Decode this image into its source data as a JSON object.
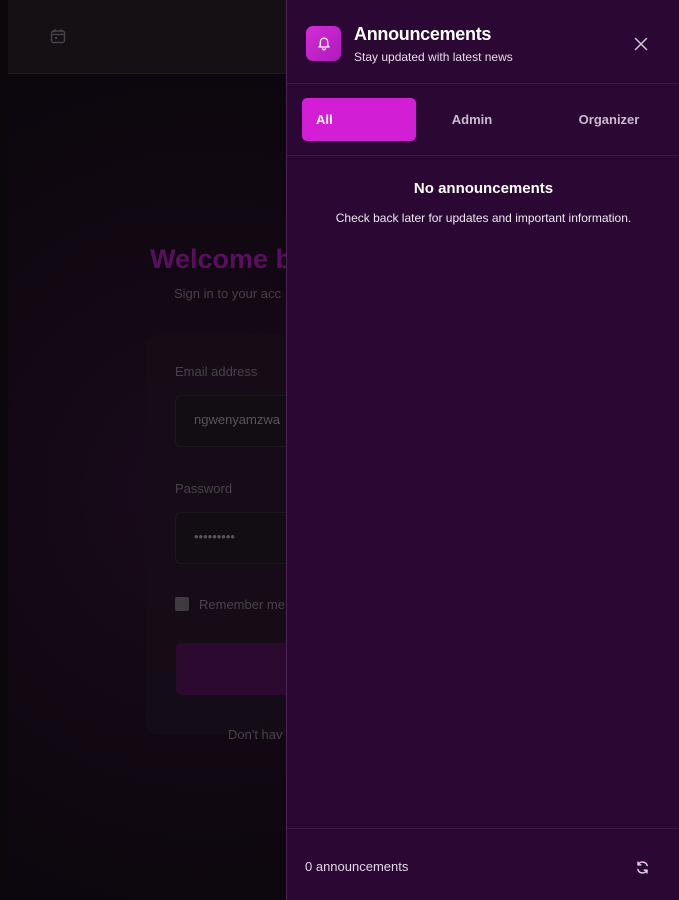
{
  "background": {
    "welcome_text": "Welcome b",
    "signin_text": "Sign in to your acc",
    "email_label": "Email address",
    "email_value": "ngwenyamzwa",
    "password_label": "Password",
    "password_value": "•••••••••",
    "remember_label": "Remember me",
    "signup_text": "Don't hav",
    "calendar_icon": "calendar-icon"
  },
  "announcements": {
    "title": "Announcements",
    "subtitle": "Stay updated with latest news",
    "header_icon": "bell-icon",
    "close_icon": "close-icon",
    "tabs": [
      {
        "label": "All",
        "active": true
      },
      {
        "label": "Admin",
        "active": false
      },
      {
        "label": "Organizer",
        "active": false
      }
    ],
    "empty_title": "No announcements",
    "empty_description": "Check back later for updates and important information.",
    "footer_count": "0 announcements",
    "refresh_icon": "refresh-icon"
  },
  "colors": {
    "panel_bg": "#2b0833",
    "accent": "#d21fd6",
    "text_primary": "#ffffff"
  }
}
